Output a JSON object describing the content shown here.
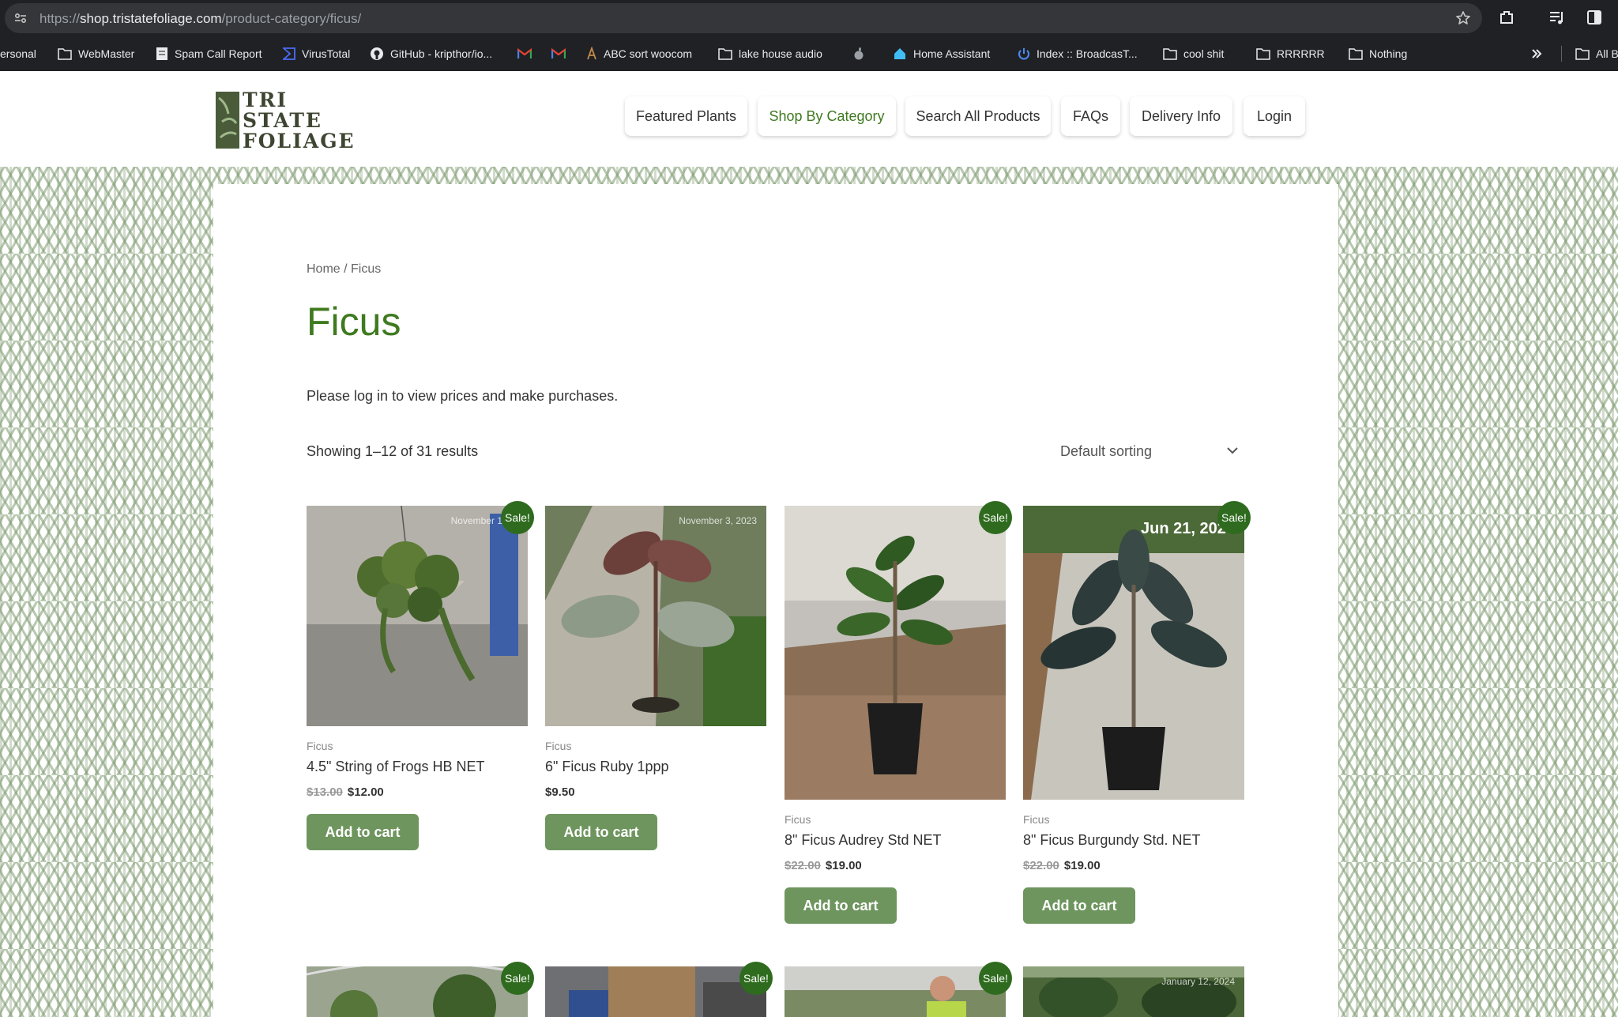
{
  "browser": {
    "url_prefix": "https://",
    "url_host": "shop.tristatefoliage.com",
    "url_path": "/product-category/ficus/",
    "bookmarks": [
      {
        "label": "ersonal",
        "icon": "none"
      },
      {
        "label": "WebMaster",
        "icon": "folder-icon"
      },
      {
        "label": "Spam Call Report",
        "icon": "page-icon"
      },
      {
        "label": "VirusTotal",
        "icon": "virustotal-icon"
      },
      {
        "label": "GitHub - kripthor/io...",
        "icon": "github-icon"
      },
      {
        "label": "",
        "icon": "gmail-icon"
      },
      {
        "label": "",
        "icon": "gmail-icon"
      },
      {
        "label": "ABC sort woocom",
        "icon": "page-icon"
      },
      {
        "label": "lake house audio",
        "icon": "folder-icon"
      },
      {
        "label": "",
        "icon": "apple-icon"
      },
      {
        "label": "Home Assistant",
        "icon": "home-assistant-icon"
      },
      {
        "label": "Index :: BroadcasT...",
        "icon": "power-icon"
      },
      {
        "label": "cool shit",
        "icon": "folder-icon"
      },
      {
        "label": "RRRRRR",
        "icon": "folder-icon"
      },
      {
        "label": "Nothing",
        "icon": "folder-icon"
      },
      {
        "label": "All B",
        "icon": "folder-icon"
      }
    ]
  },
  "site": {
    "logo_lines": [
      "TRI",
      "STATE",
      "FOLIAGE"
    ],
    "nav": [
      "Featured Plants",
      "Shop By Category",
      "Search All Products",
      "FAQs",
      "Delivery Info",
      "Login"
    ],
    "active_nav": "Shop By Category"
  },
  "page": {
    "breadcrumb_home": "Home",
    "breadcrumb_sep": " / ",
    "breadcrumb_current": "Ficus",
    "title": "Ficus",
    "login_notice": "Please log in to view prices and make purchases.",
    "result_count": "Showing 1–12 of 31 results",
    "sorting": "Default sorting"
  },
  "products": [
    {
      "category": "Ficus",
      "name": "4.5\" String of Frogs HB NET",
      "old_price": "$13.00",
      "price": "$12.00",
      "sale": "Sale!",
      "date": "November 10, 2",
      "button": "Add to cart"
    },
    {
      "category": "Ficus",
      "name": "6\" Ficus Ruby 1ppp",
      "old_price": "",
      "price": "$9.50",
      "sale": "",
      "date": "November 3, 2023",
      "button": "Add to cart"
    },
    {
      "category": "Ficus",
      "name": "8\" Ficus Audrey Std NET",
      "old_price": "$22.00",
      "price": "$19.00",
      "sale": "Sale!",
      "date": "",
      "button": "Add to cart"
    },
    {
      "category": "Ficus",
      "name": "8\" Ficus Burgundy Std. NET",
      "old_price": "$22.00",
      "price": "$19.00",
      "sale": "Sale!",
      "date": "Jun 21, 2023",
      "button": "Add to cart"
    }
  ],
  "second_row": [
    {
      "sale": "Sale!",
      "date": ""
    },
    {
      "sale": "Sale!",
      "date": ""
    },
    {
      "sale": "Sale!",
      "date": ""
    },
    {
      "sale": "",
      "date": "January 12, 2024"
    }
  ],
  "colors": {
    "brand_green": "#3f7a20",
    "button_green": "#6e955e",
    "sale_badge": "#2e6b1e"
  }
}
